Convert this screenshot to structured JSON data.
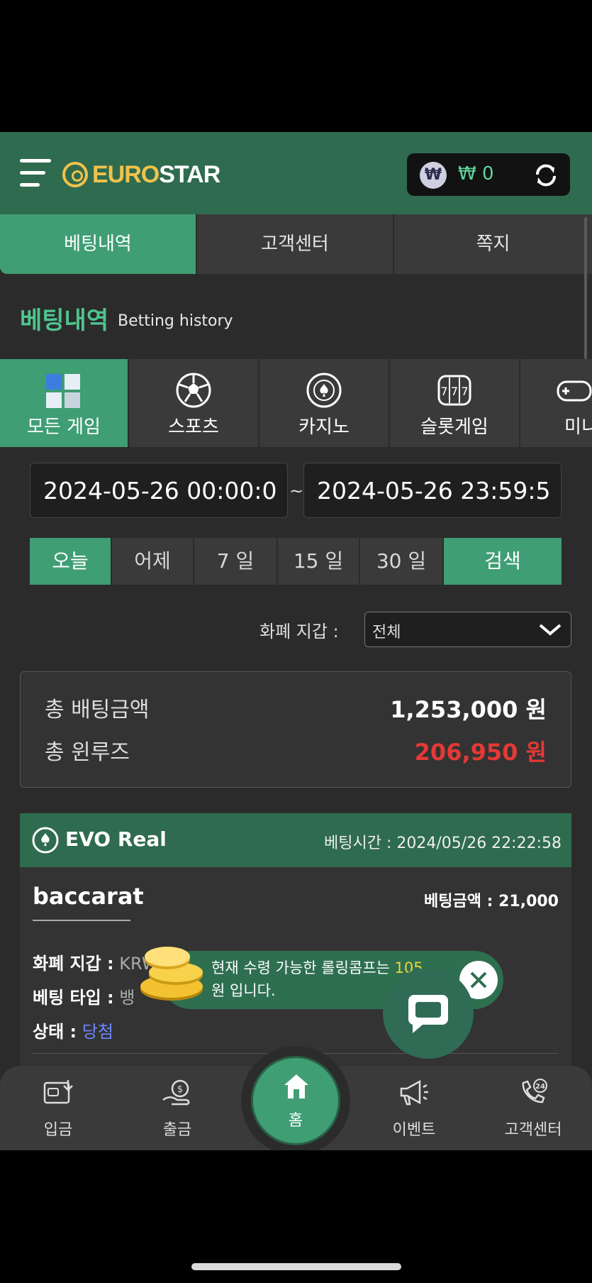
{
  "header": {
    "logo_part1": "EURO",
    "logo_part2": "STAR",
    "wallet_currency_symbol": "₩",
    "wallet_balance": "₩ 0"
  },
  "top_tabs": [
    {
      "label": "베팅내역",
      "active": true
    },
    {
      "label": "고객센터",
      "active": false
    },
    {
      "label": "쪽지",
      "active": false
    }
  ],
  "section": {
    "title": "베팅내역",
    "subtitle": "Betting history"
  },
  "categories": [
    {
      "label": "모든 게임",
      "icon": "all-games-icon",
      "active": true
    },
    {
      "label": "스포츠",
      "icon": "soccer-ball-icon",
      "active": false
    },
    {
      "label": "카지노",
      "icon": "casino-chip-icon",
      "active": false
    },
    {
      "label": "슬롯게임",
      "icon": "slot-777-icon",
      "active": false
    },
    {
      "label": "미니",
      "icon": "gamepad-icon",
      "active": false
    }
  ],
  "date_range": {
    "start": "2024-05-26 00:00:0",
    "separator": "~",
    "end": "2024-05-26 23:59:5"
  },
  "quick_ranges": [
    {
      "label": "오늘",
      "active": true
    },
    {
      "label": "어제",
      "active": false
    },
    {
      "label": "7 일",
      "active": false
    },
    {
      "label": "15 일",
      "active": false
    },
    {
      "label": "30 일",
      "active": false
    }
  ],
  "search_label": "검색",
  "currency_filter": {
    "label": "화폐 지갑 :",
    "value": "전체"
  },
  "summary": {
    "total_bet_label": "총 배팅금액",
    "total_bet_value": "1,253,000 원",
    "total_winloss_label": "총 윈루즈",
    "total_winloss_value": "206,950 원",
    "winloss_color": "#e53935"
  },
  "bet": {
    "provider": "EVO Real",
    "time_label": "베팅시간 :",
    "time_value": "2024/05/26 22:22:58",
    "game": "baccarat",
    "amount_label": "베팅금액 :",
    "amount_value": "21,000",
    "wallet_label": "화폐 지갑 :",
    "wallet_value": "KRW",
    "type_label": "베팅 타입 :",
    "type_value": "뱅",
    "status_label": "상태 :",
    "status_value": "당첨",
    "status_color": "#6e86ff"
  },
  "popup": {
    "line1_prefix": "현재 수령 가능한 롤링콤프는 ",
    "line1_value": "105",
    "line2": "원 입니다."
  },
  "bottom_nav": [
    {
      "label": "입금",
      "icon": "deposit-icon"
    },
    {
      "label": "출금",
      "icon": "withdraw-icon"
    },
    {
      "label": "홈",
      "icon": "home-icon"
    },
    {
      "label": "이벤트",
      "icon": "megaphone-icon"
    },
    {
      "label": "고객센터",
      "icon": "support-24-icon"
    }
  ],
  "colors": {
    "accent": "#3f9e73",
    "header_bg": "#2f6b4f",
    "brand_gold": "#f0c24b"
  }
}
